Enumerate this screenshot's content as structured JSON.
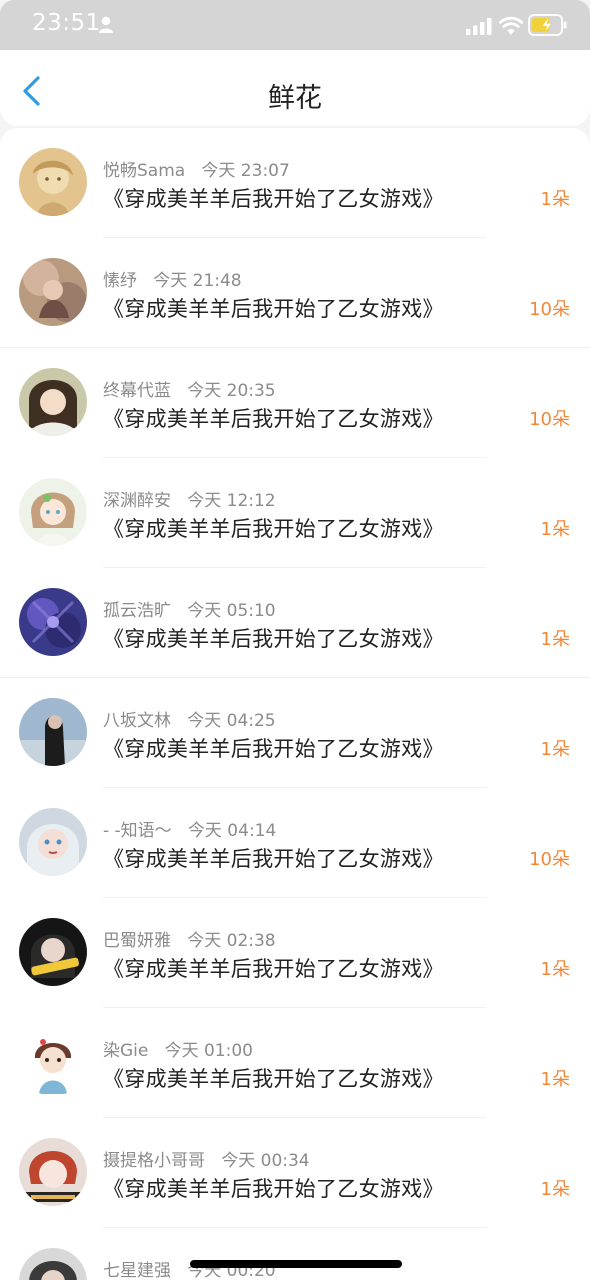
{
  "status": {
    "time": "23:51"
  },
  "nav": {
    "title": "鲜花"
  },
  "items": [
    {
      "name": "悦畅Sama",
      "time": "今天 23:07",
      "book": "《穿成美羊羊后我开始了乙女游戏》",
      "count": "1朵",
      "avatar": "avatar-1"
    },
    {
      "name": "愫纾",
      "time": "今天 21:48",
      "book": "《穿成美羊羊后我开始了乙女游戏》",
      "count": "10朵",
      "avatar": "avatar-2"
    },
    {
      "name": "终幕代蓝",
      "time": "今天 20:35",
      "book": "《穿成美羊羊后我开始了乙女游戏》",
      "count": "10朵",
      "avatar": "avatar-3"
    },
    {
      "name": "深渊醉安",
      "time": "今天 12:12",
      "book": "《穿成美羊羊后我开始了乙女游戏》",
      "count": "1朵",
      "avatar": "avatar-4"
    },
    {
      "name": "孤云浩旷",
      "time": "今天 05:10",
      "book": "《穿成美羊羊后我开始了乙女游戏》",
      "count": "1朵",
      "avatar": "avatar-5"
    },
    {
      "name": "八坂文林",
      "time": "今天 04:25",
      "book": "《穿成美羊羊后我开始了乙女游戏》",
      "count": "1朵",
      "avatar": "avatar-6"
    },
    {
      "name": "- -知语～",
      "time": "今天 04:14",
      "book": "《穿成美羊羊后我开始了乙女游戏》",
      "count": "10朵",
      "avatar": "avatar-7"
    },
    {
      "name": "巴蜀妍雅",
      "time": "今天 02:38",
      "book": "《穿成美羊羊后我开始了乙女游戏》",
      "count": "1朵",
      "avatar": "avatar-8"
    },
    {
      "name": "染Gie",
      "time": "今天 01:00",
      "book": "《穿成美羊羊后我开始了乙女游戏》",
      "count": "1朵",
      "avatar": "avatar-9"
    },
    {
      "name": "摄提格小哥哥",
      "time": "今天 00:34",
      "book": "《穿成美羊羊后我开始了乙女游戏》",
      "count": "1朵",
      "avatar": "avatar-10"
    },
    {
      "name": "七星建强",
      "time": "今天 00:20",
      "book": "",
      "count": "",
      "avatar": "avatar-11"
    }
  ],
  "colors": {
    "accent": "#f0883a",
    "back": "#2f9be0"
  }
}
